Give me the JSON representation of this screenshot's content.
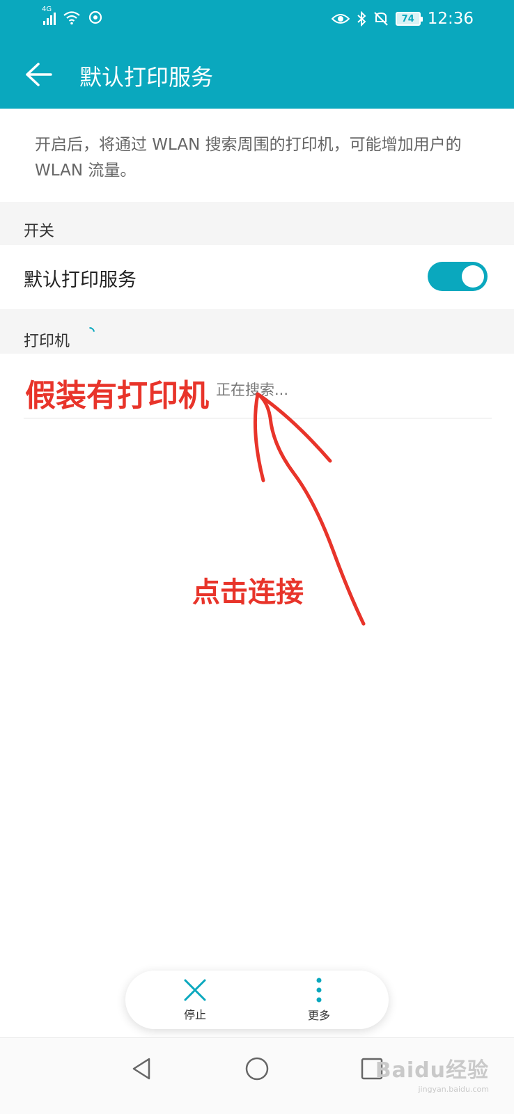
{
  "colors": {
    "accent": "#0aa8be",
    "annotation": "#e8342a"
  },
  "status_bar": {
    "network": "4G",
    "battery": "74",
    "time": "12:36",
    "icons": [
      "signal-icon",
      "wifi-icon",
      "sync-icon",
      "eye-icon",
      "bluetooth-icon",
      "mute-icon",
      "battery-icon"
    ]
  },
  "header": {
    "title": "默认打印服务",
    "back_icon": "arrow-left-icon"
  },
  "description": "开启后，将通过 WLAN 搜索周围的打印机，可能增加用户的 WLAN 流量。",
  "switch_section": {
    "label": "开关",
    "row_label": "默认打印服务",
    "toggle_on": true
  },
  "printer_section": {
    "label": "打印机",
    "status": "正在搜索..."
  },
  "annotations": {
    "note1": "假装有打印机",
    "note2": "点击连接"
  },
  "toolbar": {
    "stop_label": "停止",
    "more_label": "更多"
  },
  "navigation": [
    "back-triangle-icon",
    "home-circle-icon",
    "recents-square-icon"
  ],
  "watermark": {
    "main": "Baidu经验",
    "sub": "jingyan.baidu.com"
  }
}
